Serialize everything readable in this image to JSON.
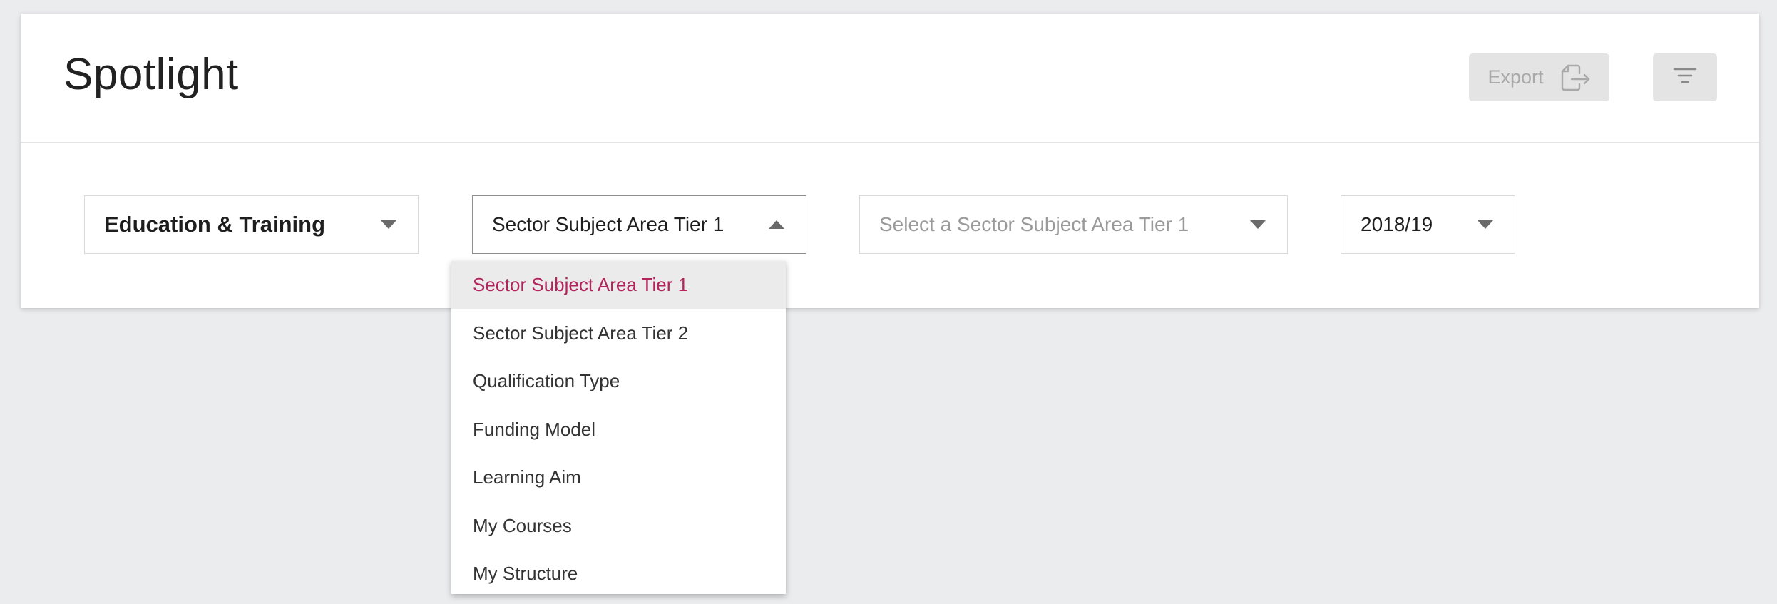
{
  "header": {
    "title": "Spotlight",
    "export_label": "Export"
  },
  "filters": {
    "area": {
      "value": "Education & Training"
    },
    "grouping": {
      "value": "Sector Subject Area Tier 1",
      "open": true
    },
    "subject": {
      "placeholder": "Select a Sector Subject Area Tier 1"
    },
    "year": {
      "value": "2018/19"
    }
  },
  "dropdown": {
    "options": [
      "Sector Subject Area Tier 1",
      "Sector Subject Area Tier 2",
      "Qualification Type",
      "Funding Model",
      "Learning Aim",
      "My Courses",
      "My Structure"
    ],
    "selected_index": 0
  },
  "colors": {
    "background": "#ebecee",
    "selected_text": "#b2245c",
    "button_bg": "#e4e4e4"
  }
}
